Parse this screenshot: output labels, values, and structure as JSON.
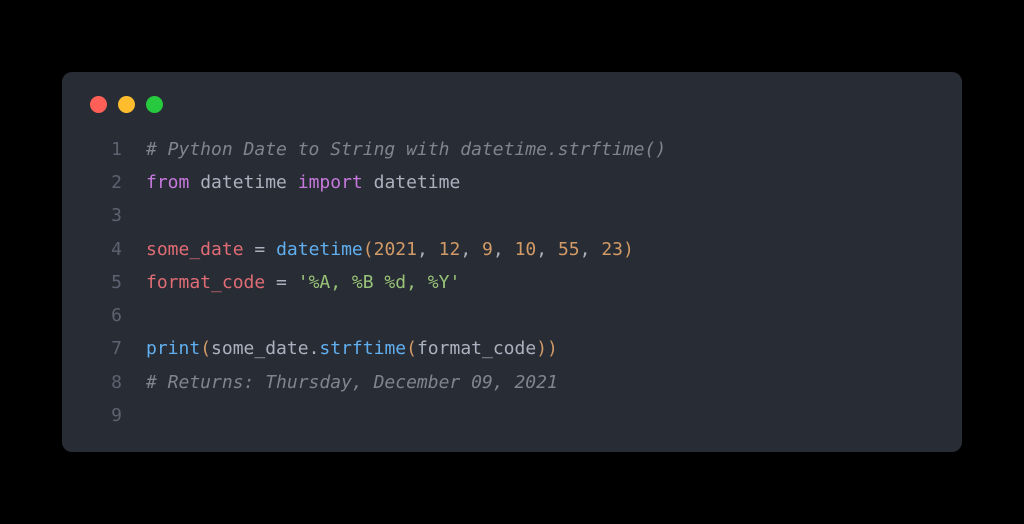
{
  "traffic_lights": {
    "red": "#ff5f56",
    "yellow": "#ffbd2e",
    "green": "#27c93f"
  },
  "code": {
    "line1": {
      "num": "1",
      "comment": "# Python Date to String with datetime.strftime()"
    },
    "line2": {
      "num": "2",
      "kw_from": "from",
      "module1": "datetime",
      "kw_import": "import",
      "module2": "datetime"
    },
    "line3": {
      "num": "3"
    },
    "line4": {
      "num": "4",
      "var": "some_date",
      "eq": " = ",
      "func": "datetime",
      "open": "(",
      "n1": "2021",
      "c1": ", ",
      "n2": "12",
      "c2": ", ",
      "n3": "9",
      "c3": ", ",
      "n4": "10",
      "c4": ", ",
      "n5": "55",
      "c5": ", ",
      "n6": "23",
      "close": ")"
    },
    "line5": {
      "num": "5",
      "var": "format_code",
      "eq": " = ",
      "str": "'%A, %B %d, %Y'"
    },
    "line6": {
      "num": "6"
    },
    "line7": {
      "num": "7",
      "print": "print",
      "open1": "(",
      "arg1": "some_date",
      "dot": ".",
      "method": "strftime",
      "open2": "(",
      "arg2": "format_code",
      "close2": ")",
      "close1": ")"
    },
    "line8": {
      "num": "8",
      "comment": "# Returns: Thursday, December 09, 2021"
    },
    "line9": {
      "num": "9"
    }
  }
}
